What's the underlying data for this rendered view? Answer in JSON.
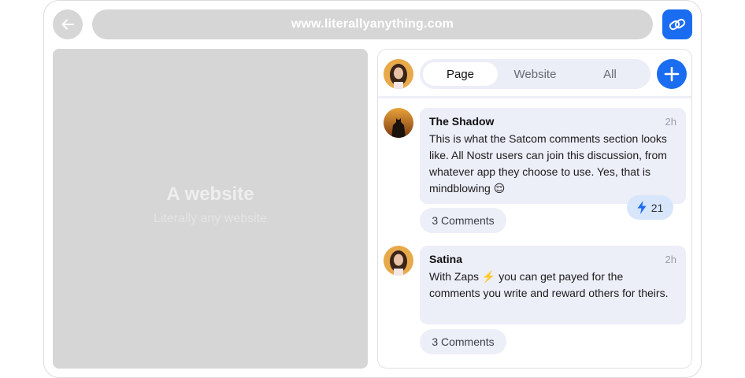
{
  "browser": {
    "url": "www.literallyanything.com",
    "back_icon": "arrow-left-icon",
    "link_icon": "link-icon",
    "accent_color": "#1a6cf0"
  },
  "website": {
    "title": "A website",
    "subtitle": "Literally any website"
  },
  "comments_panel": {
    "tabs": [
      {
        "label": "Page",
        "active": true
      },
      {
        "label": "Website",
        "active": false
      },
      {
        "label": "All",
        "active": false
      }
    ],
    "add_icon": "plus-icon",
    "comments": [
      {
        "author": "The Shadow",
        "time": "2h",
        "text": "This is what the Satcom comments section looks like. All Nostr users can join this discussion, from whatever app they choose to use. Yes, that is mindblowing 😌",
        "zaps": "21",
        "replies_label": "3 Comments"
      },
      {
        "author": "Satina",
        "time": "2h",
        "text": "With Zaps ⚡️  you can get payed for the comments you write and reward others for theirs.",
        "replies_label": "3 Comments"
      }
    ]
  }
}
